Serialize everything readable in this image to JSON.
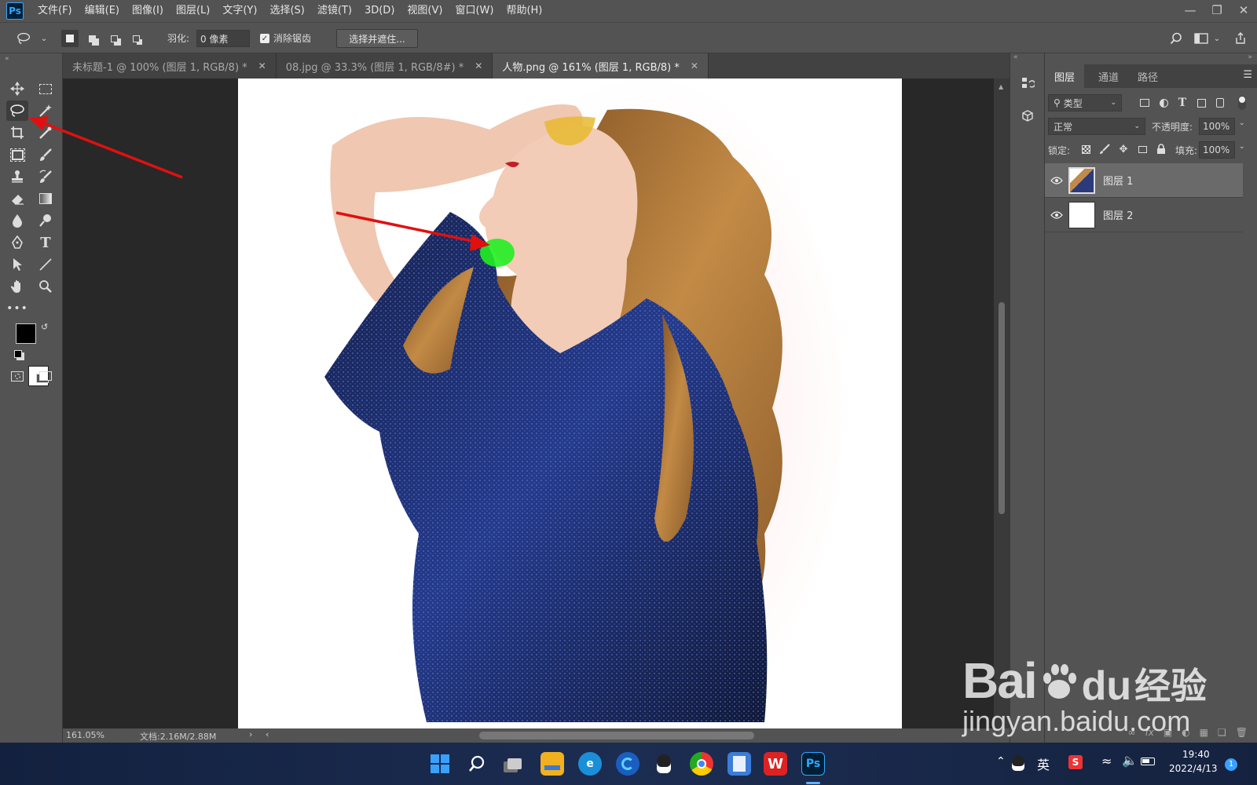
{
  "app": {
    "logo": "Ps"
  },
  "menu": [
    "文件(F)",
    "编辑(E)",
    "图像(I)",
    "图层(L)",
    "文字(Y)",
    "选择(S)",
    "滤镜(T)",
    "3D(D)",
    "视图(V)",
    "窗口(W)",
    "帮助(H)"
  ],
  "options": {
    "feather_label": "羽化:",
    "feather_value": "0 像素",
    "antialias_label": "消除锯齿",
    "antialias_checked": true,
    "select_mask_button": "选择并遮住..."
  },
  "tabs": [
    {
      "label": "未标题-1 @ 100% (图层 1, RGB/8) *",
      "active": false
    },
    {
      "label": "08.jpg @ 33.3% (图层 1, RGB/8#) *",
      "active": false
    },
    {
      "label": "人物.png @ 161% (图层 1, RGB/8) *",
      "active": true
    }
  ],
  "status": {
    "zoom": "161.05%",
    "doc": "文档:2.16M/2.88M"
  },
  "layers_panel": {
    "tabs": [
      "图层",
      "通道",
      "路径"
    ],
    "filter_label": "类型",
    "blend_mode": "正常",
    "opacity_label": "不透明度:",
    "opacity_value": "100%",
    "lock_label": "锁定:",
    "fill_label": "填充:",
    "fill_value": "100%",
    "layers": [
      {
        "name": "图层 1",
        "selected": true
      },
      {
        "name": "图层 2",
        "selected": false
      }
    ]
  },
  "taskbar": {
    "ime": "英",
    "time": "19:40",
    "date": "2022/4/13",
    "notification_count": "1"
  },
  "watermark": {
    "brand": "Bai",
    "brand2": "du",
    "cn": "经验",
    "url": "jingyan.baidu.com"
  },
  "colors": {
    "accent": "#31a8ff",
    "arrow": "#e01010",
    "green_spot": "#22ee22",
    "shirt": "#1a2a6a",
    "hair": "#b07838"
  }
}
